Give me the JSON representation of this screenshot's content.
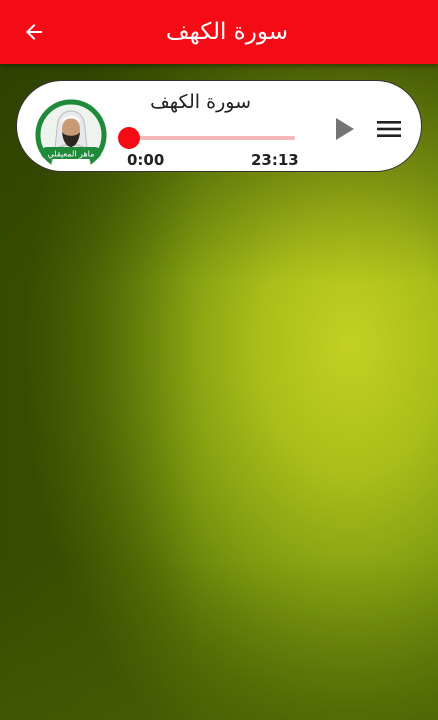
{
  "app_bar": {
    "title": "سورة الكهف",
    "back_icon": "arrow-back-icon",
    "background_color": "#f40b16"
  },
  "player": {
    "track_title": "سورة الكهف",
    "reciter_avatar_icon": "reciter-portrait",
    "reciter_name_on_badge": "ماهر المعيقلي",
    "current_time": "0:00",
    "total_time": "23:13",
    "progress_fraction": 0.0,
    "play_icon": "play-icon",
    "menu_icon": "menu-icon",
    "accent_color": "#f40b16",
    "track_color": "#f6b7b9",
    "play_icon_color": "#757575"
  },
  "background": {
    "colors": [
      "#3e5502",
      "#7f9a10",
      "#c2d122"
    ]
  }
}
